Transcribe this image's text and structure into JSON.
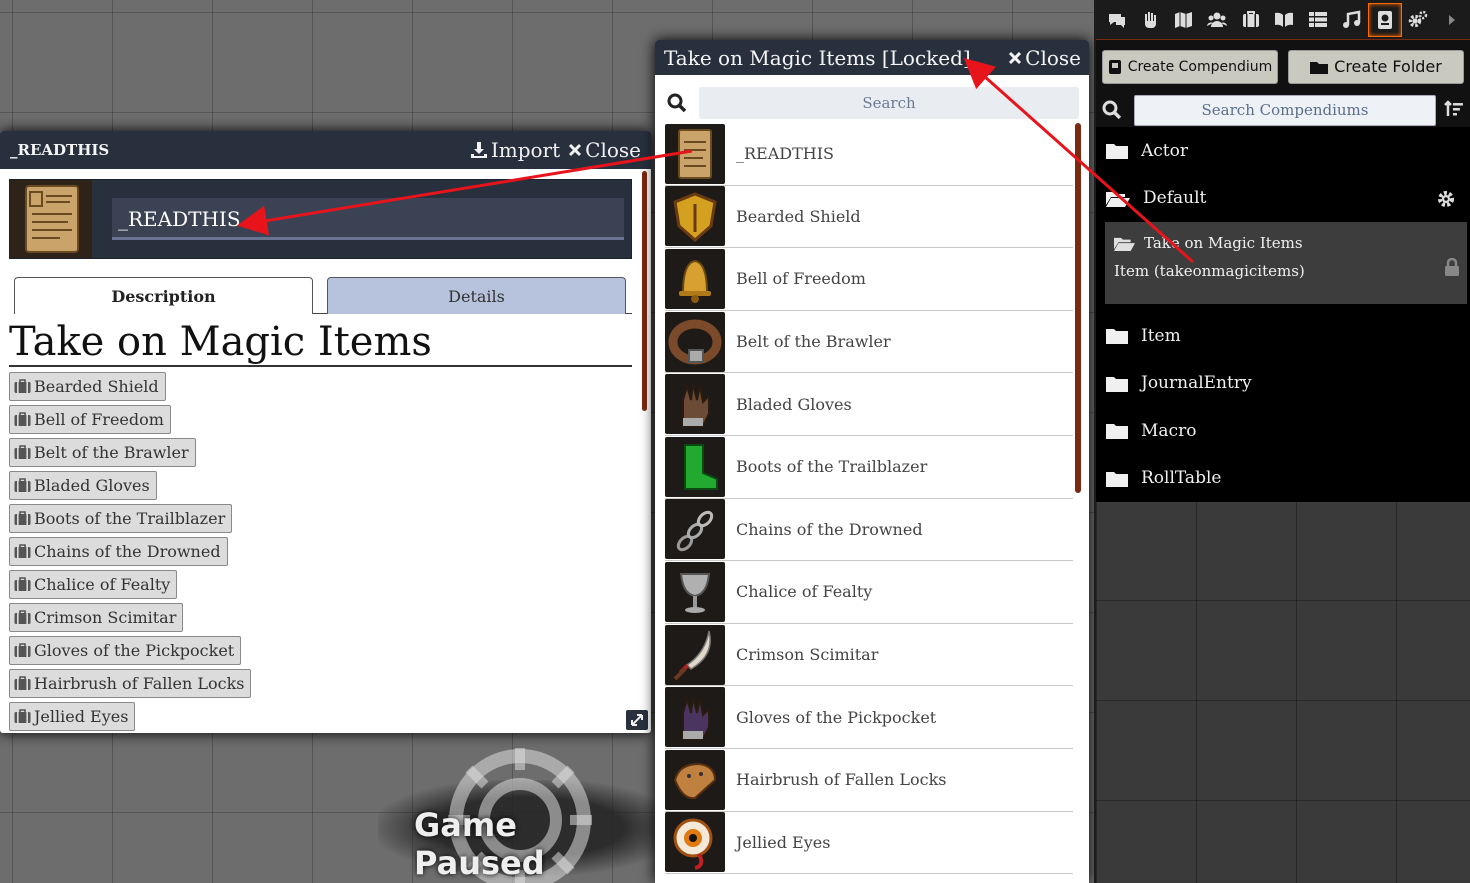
{
  "game_paused": {
    "label": "Game Paused"
  },
  "item_sheet": {
    "title": "_READTHIS",
    "import_label": "Import",
    "close_label": "Close",
    "item_name": "_READTHIS",
    "tabs": [
      {
        "label": "Description",
        "active": true
      },
      {
        "label": "Details",
        "active": false
      }
    ],
    "description_heading": "Take on Magic Items",
    "links": [
      {
        "label": "Bearded Shield"
      },
      {
        "label": "Bell of Freedom"
      },
      {
        "label": "Belt of the Brawler"
      },
      {
        "label": "Bladed Gloves"
      },
      {
        "label": "Boots of the Trailblazer"
      },
      {
        "label": "Chains of the Drowned"
      },
      {
        "label": "Chalice of Fealty"
      },
      {
        "label": "Crimson Scimitar"
      },
      {
        "label": "Gloves of the Pickpocket"
      },
      {
        "label": "Hairbrush of Fallen Locks"
      },
      {
        "label": "Jellied Eyes"
      }
    ]
  },
  "compendium": {
    "title": "Take on Magic Items [Locked]",
    "close_label": "Close",
    "search_placeholder": "Search",
    "items": [
      {
        "name": "_READTHIS",
        "icon": "scroll-icon",
        "color": "#8a6a3c"
      },
      {
        "name": "Bearded Shield",
        "icon": "shield-icon",
        "color": "#6a3a12"
      },
      {
        "name": "Bell of Freedom",
        "icon": "bell-icon",
        "color": "#a07320"
      },
      {
        "name": "Belt of the Brawler",
        "icon": "belt-icon",
        "color": "#5a3420"
      },
      {
        "name": "Bladed Gloves",
        "icon": "glove-icon",
        "color": "#6b4a36"
      },
      {
        "name": "Boots of the Trailblazer",
        "icon": "boot-icon",
        "color": "#1e8a2a"
      },
      {
        "name": "Chains of the Drowned",
        "icon": "chain-icon",
        "color": "#3a3f46"
      },
      {
        "name": "Chalice of Fealty",
        "icon": "chalice-icon",
        "color": "#7a1418"
      },
      {
        "name": "Crimson Scimitar",
        "icon": "scimitar-icon",
        "color": "#5a3a2a"
      },
      {
        "name": "Gloves of the Pickpocket",
        "icon": "glove-icon",
        "color": "#4a3560"
      },
      {
        "name": "Hairbrush of Fallen Locks",
        "icon": "hairbrush-icon",
        "color": "#7a4a28"
      },
      {
        "name": "Jellied Eyes",
        "icon": "eye-icon",
        "color": "#b04a10"
      }
    ]
  },
  "sidebar": {
    "tab_icons": [
      "chat-icon",
      "combat-icon",
      "scenes-icon",
      "actors-icon",
      "items-icon",
      "journal-icon",
      "tables-icon",
      "playlists-icon",
      "compendium-icon",
      "settings-icon",
      "collapse-icon"
    ],
    "active_tab": "compendium-icon",
    "create_compendium_label": "Create Compendium",
    "create_folder_label": "Create Folder",
    "search_placeholder": "Search Compendiums",
    "folders_top": [
      {
        "label": "Actor"
      },
      {
        "label": "Default"
      }
    ],
    "pack": {
      "name": "Take on Magic Items",
      "subtitle": "Item (takeonmagicitems)"
    },
    "folders_bottom": [
      {
        "label": "Item"
      },
      {
        "label": "JournalEntry"
      },
      {
        "label": "Macro"
      },
      {
        "label": "RollTable"
      }
    ],
    "accent_color": "#ff6a00"
  },
  "annotation_color": "#e8141c"
}
